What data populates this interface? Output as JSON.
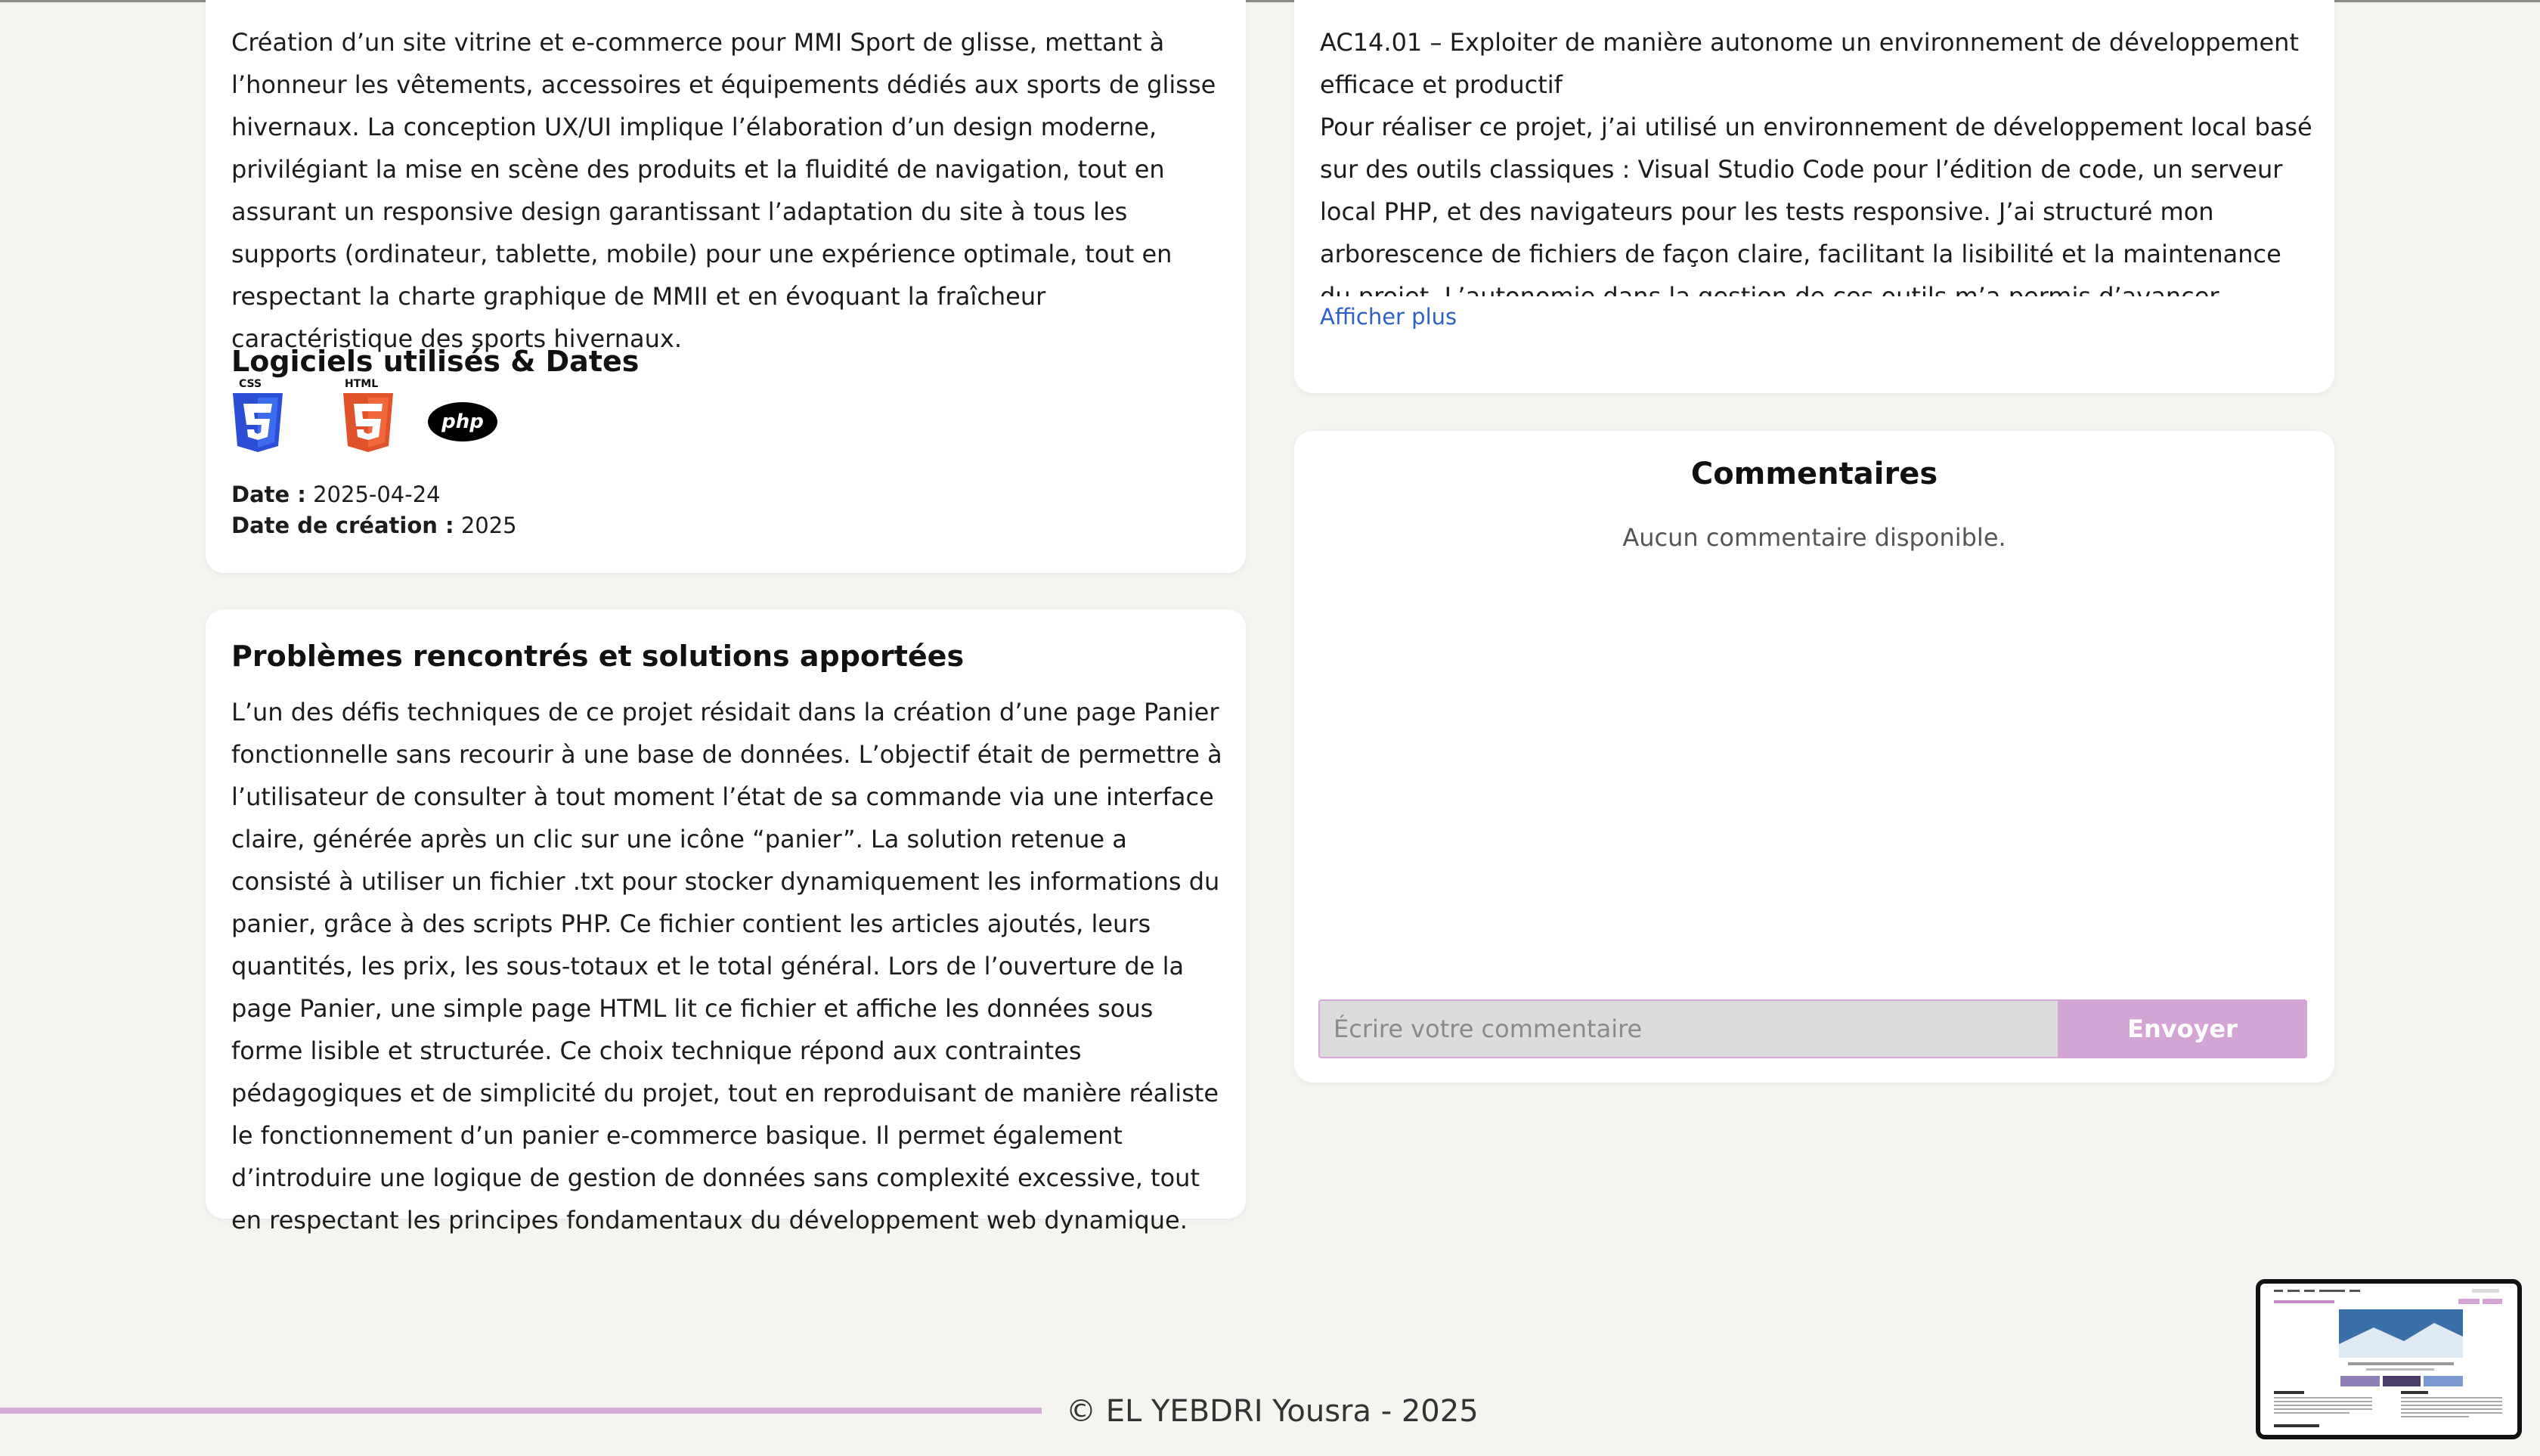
{
  "project_card": {
    "description": "Création d’un site vitrine et e-commerce pour MMI Sport de glisse, mettant à l’honneur les vêtements, accessoires et équipements dédiés aux sports de glisse hivernaux. La conception UX/UI implique l’élaboration d’un design moderne, privilégiant la mise en scène des produits et la fluidité de navigation, tout en assurant un responsive design garantissant l’adaptation du site à tous les supports (ordinateur, tablette, mobile) pour une expérience optimale, tout en respectant la charte graphique de MMII et en évoquant la fraîcheur caractéristique des sports hivernaux.",
    "software_heading": "Logiciels utilisés & Dates",
    "software": [
      {
        "name": "CSS",
        "icon": "css3-icon",
        "color": "#2a4fd6"
      },
      {
        "name": "HTML",
        "icon": "html5-icon",
        "color": "#e0532a"
      },
      {
        "name": "php",
        "icon": "php-icon",
        "color": "#000000"
      }
    ],
    "date_label": "Date :",
    "date_value": "2025-04-24",
    "creation_label": "Date de création :",
    "creation_value": "2025"
  },
  "problems_card": {
    "heading": "Problèmes rencontrés et solutions apportées",
    "text": "L’un des défis techniques de ce projet résidait dans la création d’une page Panier fonctionnelle sans recourir à une base de données. L’objectif était de permettre à l’utilisateur de consulter à tout moment l’état de sa commande via une interface claire, générée après un clic sur une icône “panier”. La solution retenue a consisté à utiliser un fichier .txt pour stocker dynamiquement les informations du panier, grâce à des scripts PHP. Ce fichier contient les articles ajoutés, leurs quantités, les prix, les sous-totaux et le total général. Lors de l’ouverture de la page Panier, une simple page HTML lit ce fichier et affiche les données sous forme lisible et structurée. Ce choix technique répond aux contraintes pédagogiques et de simplicité du projet, tout en reproduisant de manière réaliste le fonctionnement d’un panier e-commerce basique. Il permet également d’introduire une logique de gestion de données sans complexité excessive, tout en respectant les principes fondamentaux du développement web dynamique."
  },
  "skills_card": {
    "title_line": "AC14.01 – Exploiter de manière autonome un environnement de développement efficace et productif",
    "text": "Pour réaliser ce projet, j’ai utilisé un environnement de développement local basé sur des outils classiques : Visual Studio Code pour l’édition de code, un serveur local PHP, et des navigateurs pour les tests responsive. J’ai structuré mon arborescence de fichiers de façon claire, facilitant la lisibilité et la maintenance du projet. L’autonomie dans la gestion de ces outils m’a permis d’avancer efficacement, sans dépendre d’un CMS ou",
    "more_link": "Afficher plus"
  },
  "comments": {
    "title": "Commentaires",
    "empty": "Aucun commentaire disponible.",
    "input_placeholder": "Écrire votre commentaire",
    "send_label": "Envoyer"
  },
  "footer": {
    "text": "© EL YEBDRI Yousra - 2025"
  },
  "colors": {
    "accent": "#d4a4d4",
    "link": "#2f5fc8",
    "background": "#f5f4f0"
  }
}
